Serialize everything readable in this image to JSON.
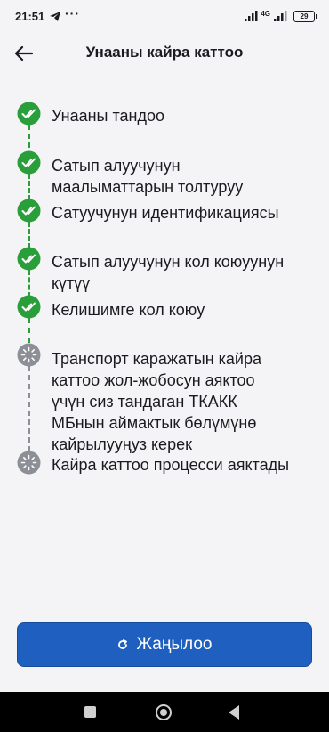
{
  "status_bar": {
    "time": "21:51",
    "dots": "···",
    "network": "4G",
    "battery": "29"
  },
  "header": {
    "title": "Унааны кайра каттоо"
  },
  "steps": [
    {
      "label": "Унааны тандоо",
      "status": "done"
    },
    {
      "label": "Сатып алуучунун маалыматтарын толтуруу",
      "status": "done"
    },
    {
      "label": "Сатуучунун идентификациясы",
      "status": "done"
    },
    {
      "label": "Сатып алуучунун кол коюуунун күтүү",
      "status": "done"
    },
    {
      "label": "Келишимге кол коюу",
      "status": "done"
    },
    {
      "label": "Транспорт каражатын кайра каттоо жол-жобосун аяктоо үчүн сиз тандаган ТКАКК МБнын аймактык бөлүмүнө кайрылууңуз керек",
      "status": "pending"
    },
    {
      "label": "Кайра каттоо процесси аяктады",
      "status": "pending"
    }
  ],
  "refresh_button": {
    "label": "Жаңылоо",
    "icon": "refresh-icon"
  },
  "colors": {
    "done": "#2a9e3a",
    "pending": "#8c8f96",
    "primary": "#1f5fbf"
  }
}
